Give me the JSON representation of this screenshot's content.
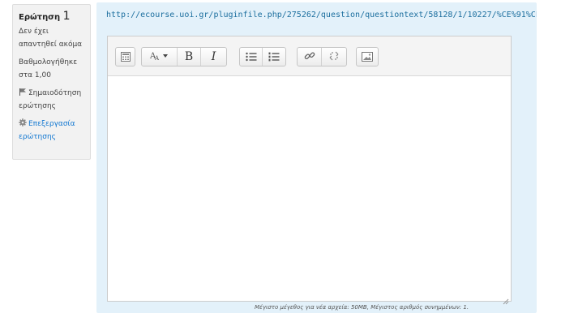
{
  "info": {
    "question_label": "Ερώτηση",
    "question_number": "1",
    "status": "Δεν έχει απαντηθεί ακόμα",
    "grade": "Βαθμολογήθηκε στα 1,00",
    "flag_label": "Σημαιοδότηση ερώτησης",
    "flag_icon": "flag-icon",
    "edit_label": "Επεξεργασία ερώτησης",
    "edit_icon": "gear-icon"
  },
  "question": {
    "url": "http://ecourse.uoi.gr/pluginfile.php/275262/question/questiontext/58128/1/10227/%CE%91%CF%80"
  },
  "editor": {
    "toolbar": [
      {
        "group": "show-more",
        "buttons": [
          {
            "icon": "toolbar-toggle-icon"
          }
        ]
      },
      {
        "group": "style",
        "buttons": [
          {
            "icon": "font-style-icon"
          },
          {
            "icon": "bold-icon",
            "label": "B"
          },
          {
            "icon": "italic-icon",
            "label": "I"
          }
        ]
      },
      {
        "group": "list",
        "buttons": [
          {
            "icon": "unordered-list-icon"
          },
          {
            "icon": "ordered-list-icon"
          }
        ]
      },
      {
        "group": "links",
        "buttons": [
          {
            "icon": "link-icon"
          },
          {
            "icon": "unlink-icon"
          }
        ]
      },
      {
        "group": "insert",
        "buttons": [
          {
            "icon": "image-icon"
          }
        ]
      }
    ],
    "content": ""
  },
  "footer": {
    "note": "Μέγιστο μέγεθος για νέα αρχεία: 50MB, Μέγιστος αριθμός συνημμένων: 1."
  },
  "colors": {
    "link": "#1177d1",
    "panel": "#e3f1fa",
    "info_bg": "#f2f2f2"
  }
}
